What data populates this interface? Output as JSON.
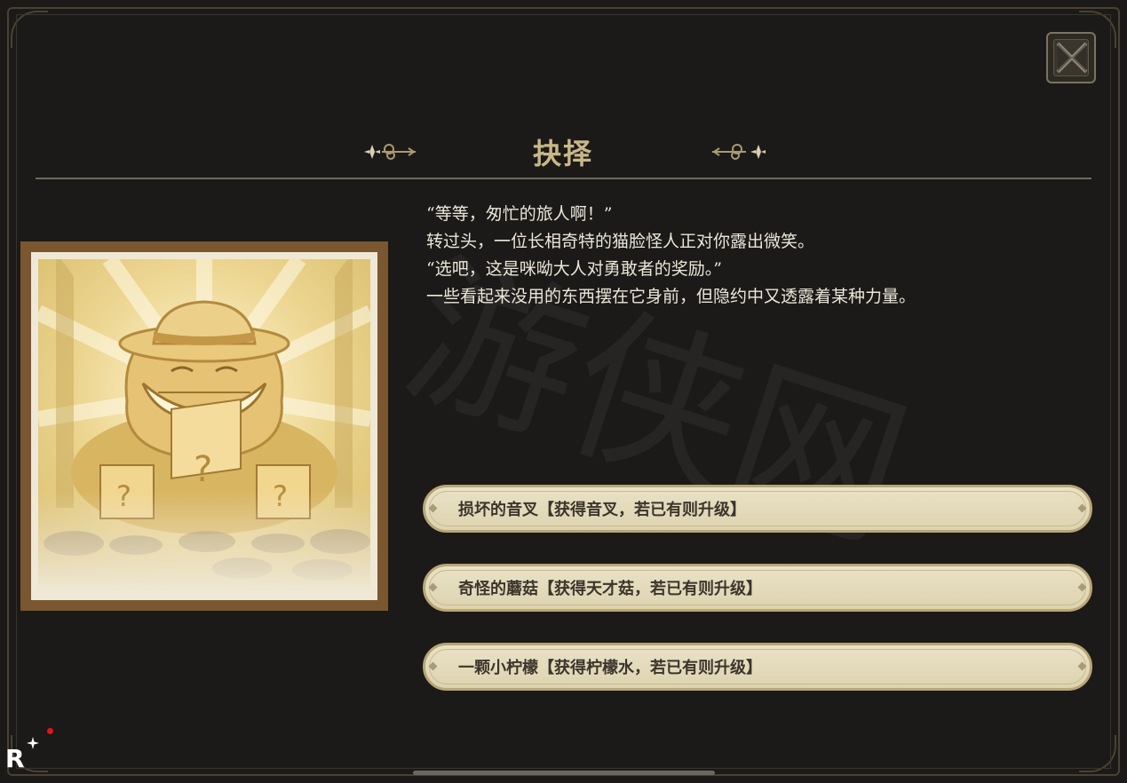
{
  "dialog": {
    "title": "抉择",
    "story_lines": [
      "“等等，匆忙的旅人啊！”",
      "转过头，一位长相奇特的猫脸怪人正对你露出微笑。",
      "“选吧，这是咪呦大人对勇敢者的奖励。”",
      "一些看起来没用的东西摆在它身前，但隐约中又透露着某种力量。"
    ],
    "choices": [
      {
        "label": "损坏的音叉【获得音叉，若已有则升级】"
      },
      {
        "label": "奇怪的蘑菇【获得天才菇，若已有则升级】"
      },
      {
        "label": "一颗小柠檬【获得柠檬水，若已有则升级】"
      }
    ]
  },
  "watermark_text": "游侠网",
  "logo_text": "R",
  "colors": {
    "background": "#1b1a18",
    "title": "#c9b788",
    "choice_fill": "#e6ddc0",
    "choice_text": "#3b352c",
    "story_text": "#ece6d8",
    "notification_dot": "#e3121c"
  },
  "icons": {
    "close": "close-x-icon",
    "ornament": "scroll-flourish-icon"
  }
}
